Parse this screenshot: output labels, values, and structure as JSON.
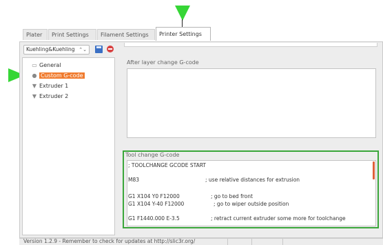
{
  "tabs": [
    {
      "label": "Plater",
      "active": false
    },
    {
      "label": "Print Settings",
      "active": false
    },
    {
      "label": "Filament Settings",
      "active": false
    },
    {
      "label": "Printer Settings",
      "active": true
    }
  ],
  "preset": {
    "selected": "Kuehling&Kuehling",
    "arrow": "⌃⌄"
  },
  "tree": {
    "items": [
      {
        "label": "General",
        "icon": "printer-icon",
        "selected": false
      },
      {
        "label": "Custom G-code",
        "icon": "gcode-icon",
        "selected": true
      },
      {
        "label": "Extruder 1",
        "icon": "extruder-icon",
        "selected": false
      },
      {
        "label": "Extruder 2",
        "icon": "extruder-icon",
        "selected": false
      }
    ]
  },
  "settings": {
    "after_layer_title": "After layer change G-code",
    "after_layer_value": "",
    "tool_change_title": "Tool change G-code",
    "tool_change_lines": [
      {
        "code": "; TOOLCHANGE GCODE START",
        "comment": ""
      },
      {
        "code": "M83",
        "comment": "; use relative distances for extrusion"
      },
      {
        "code": "G1 X104 Y0 F12000",
        "comment": "; go to bed front"
      },
      {
        "code": "G1 X104 Y-40 F12000",
        "comment": "; go to wiper outside position"
      },
      {
        "code": "G1 F1440.000 E-3.5",
        "comment": "; retract current extruder some more for toolchange"
      }
    ]
  },
  "status": {
    "text": "Version 1.2.9 - Remember to check for updates at http://slic3r.org/"
  },
  "colors": {
    "highlight": "#f07b2e",
    "annotation_arrow": "#36d636",
    "annotation_frame": "#3aa63a",
    "save": "#3a6fc4",
    "delete": "#d84040"
  }
}
